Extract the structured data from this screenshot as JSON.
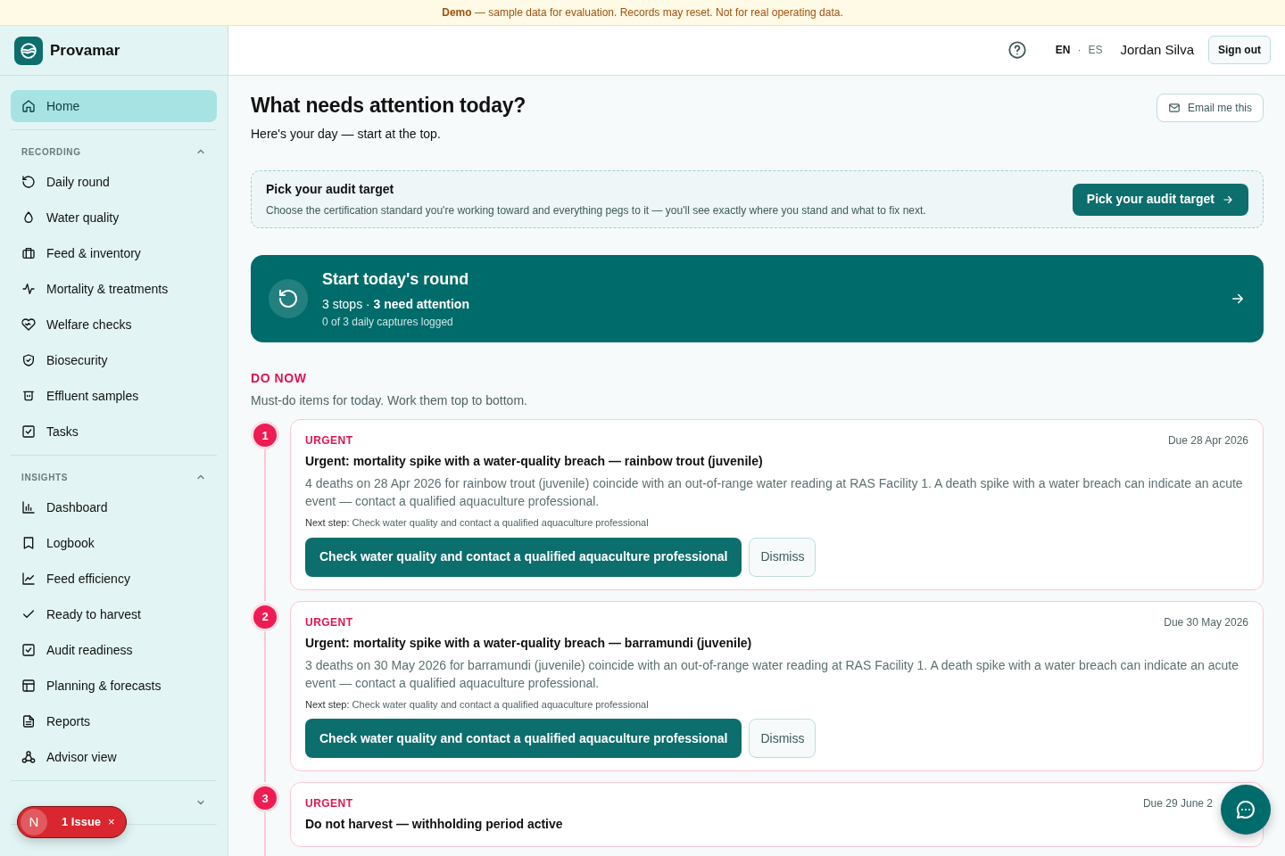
{
  "banner": {
    "text": "**Demo** — sample data for evaluation. Records may reset. Not for real operating data."
  },
  "brand": {
    "name": "Provamar"
  },
  "sidebar": {
    "home": {
      "label": "Home",
      "selected": true
    },
    "sections": [
      {
        "label": "RECORDING",
        "expanded": true,
        "items": [
          {
            "label": "Daily round",
            "selected": false
          },
          {
            "label": "Water quality",
            "selected": false
          },
          {
            "label": "Feed & inventory",
            "selected": false
          },
          {
            "label": "Mortality & treatments",
            "selected": false
          },
          {
            "label": "Welfare checks",
            "selected": false
          },
          {
            "label": "Biosecurity",
            "selected": false
          },
          {
            "label": "Effluent samples",
            "selected": false
          },
          {
            "label": "Tasks",
            "selected": false
          }
        ]
      },
      {
        "label": "INSIGHTS",
        "expanded": true,
        "items": [
          {
            "label": "Dashboard",
            "selected": false
          },
          {
            "label": "Logbook",
            "selected": false
          },
          {
            "label": "Feed efficiency",
            "selected": false
          },
          {
            "label": "Ready to harvest",
            "selected": false
          },
          {
            "label": "Audit readiness",
            "selected": false
          },
          {
            "label": "Planning & forecasts",
            "selected": false
          },
          {
            "label": "Reports",
            "selected": false
          },
          {
            "label": "Advisor view",
            "selected": false
          }
        ]
      },
      {
        "expanded": false
      }
    ]
  },
  "issue_badge": {
    "letter": "N",
    "label": "1 Issue",
    "close": "×"
  },
  "topbar": {
    "languages": [
      {
        "label": "EN",
        "selected": true
      },
      {
        "label": "ES",
        "selected": false
      }
    ],
    "separator": "·",
    "user": "Jordan Silva",
    "sign_out": "Sign out"
  },
  "page": {
    "title": "What needs attention today?",
    "subtitle": "Here's your day — start at the top.",
    "email_button": "Email me this"
  },
  "audit_prompt": {
    "title": "Pick your audit target",
    "text": "Choose the certification standard you're working toward and everything pegs to it — you'll see exactly where you stand and what to fix next.",
    "button": "Pick your audit target"
  },
  "round_card": {
    "title": "Start today's round",
    "summary": "3 stops · **3 need attention**",
    "detail": "0 of 3 daily captures logged"
  },
  "do_now": {
    "heading": "DO NOW",
    "subtitle": "Must-do items for today. Work them top to bottom.",
    "items": [
      {
        "number": "1",
        "tag": "URGENT",
        "due": "Due 28 Apr 2026",
        "title": "Urgent: mortality spike with a water-quality breach — rainbow trout (juvenile)",
        "body": "4 deaths on 28 Apr 2026 for rainbow trout (juvenile) coincide with an out-of-range water reading at RAS Facility 1. A death spike with a water breach can indicate an acute event — contact a qualified aquaculture professional.",
        "next_step": "**Next step:** Check water quality and contact a qualified aquaculture professional",
        "action": "Check water quality and contact a qualified aquaculture professional",
        "dismiss": "Dismiss"
      },
      {
        "number": "2",
        "tag": "URGENT",
        "due": "Due 30 May 2026",
        "title": "Urgent: mortality spike with a water-quality breach — barramundi (juvenile)",
        "body": "3 deaths on 30 May 2026 for barramundi (juvenile) coincide with an out-of-range water reading at RAS Facility 1. A death spike with a water breach can indicate an acute event — contact a qualified aquaculture professional.",
        "next_step": "**Next step:** Check water quality and contact a qualified aquaculture professional",
        "action": "Check water quality and contact a qualified aquaculture professional",
        "dismiss": "Dismiss"
      },
      {
        "number": "3",
        "tag": "URGENT",
        "due": "Due 29 June 2",
        "title": "Do not harvest — withholding period active"
      }
    ]
  }
}
